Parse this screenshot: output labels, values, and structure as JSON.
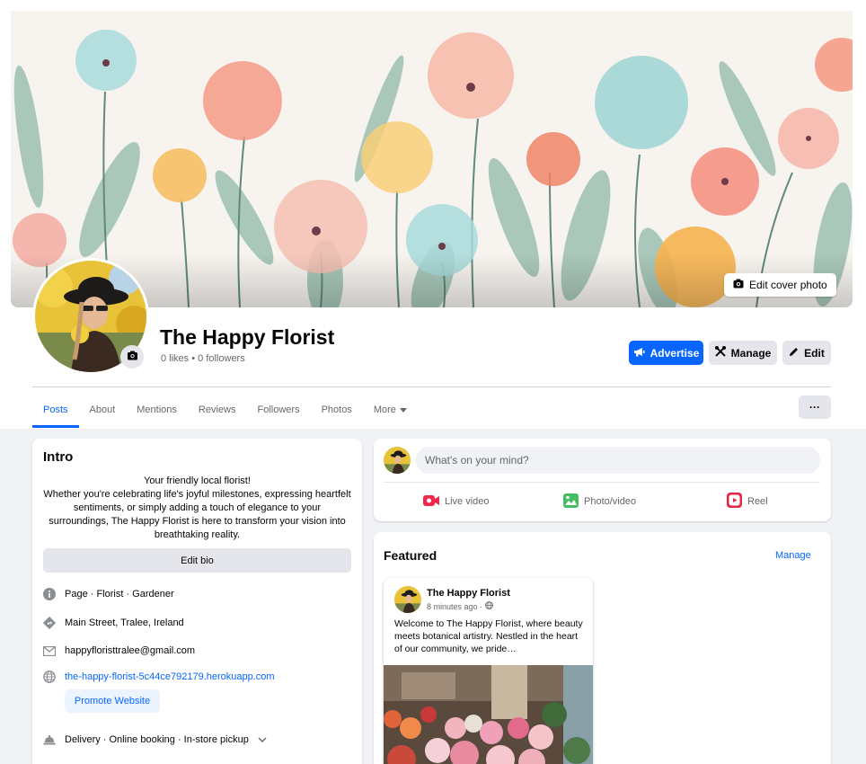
{
  "cover": {
    "edit_label": "Edit cover photo"
  },
  "page": {
    "title": "The Happy Florist",
    "stats": "0 likes • 0 followers"
  },
  "actions": {
    "advertise": "Advertise",
    "manage": "Manage",
    "edit": "Edit"
  },
  "tabs": [
    {
      "label": "Posts",
      "active": true
    },
    {
      "label": "About"
    },
    {
      "label": "Mentions"
    },
    {
      "label": "Reviews"
    },
    {
      "label": "Followers"
    },
    {
      "label": "Photos"
    },
    {
      "label": "More"
    }
  ],
  "tabs_more_button": "···",
  "intro": {
    "title": "Intro",
    "bio": "Your friendly local florist!\nWhether you're celebrating life's joyful milestones, expressing heartfelt sentiments, or simply adding a touch of elegance to your surroundings, The Happy Florist is here to transform your vision into breathtaking reality.",
    "edit_bio": "Edit bio",
    "category": "Page · Florist · Gardener",
    "address": "Main Street, Tralee, Ireland",
    "email": "happyfloristtralee@gmail.com",
    "website": "the-happy-florist-5c44ce792179.herokuapp.com",
    "promote": "Promote Website",
    "services": "Delivery · Online booking · In-store pickup"
  },
  "composer": {
    "placeholder": "What's on your mind?",
    "live": "Live video",
    "photo": "Photo/video",
    "reel": "Reel"
  },
  "featured": {
    "title": "Featured",
    "manage": "Manage",
    "post": {
      "author": "The Happy Florist",
      "time": "8 minutes ago ·",
      "text": "Welcome to The Happy Florist, where beauty meets botanical artistry. Nestled in the heart of our community, we pride…"
    }
  },
  "colors": {
    "accent": "#0866ff",
    "background": "#f0f2f5",
    "secondary_button": "#e4e6eb"
  }
}
